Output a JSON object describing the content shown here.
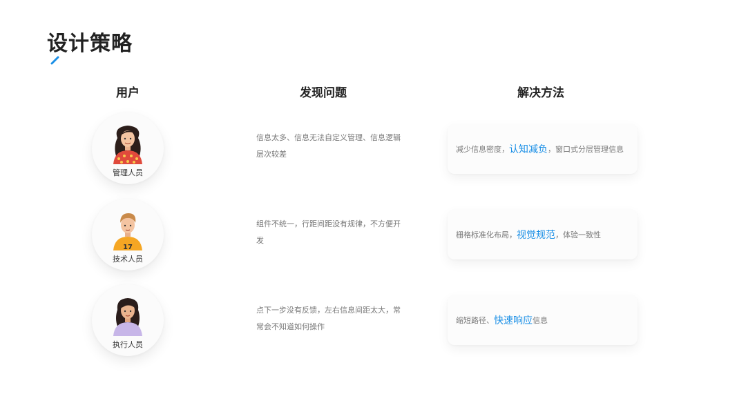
{
  "page": {
    "title": "设计策略",
    "accent_color": "#1a8fe6"
  },
  "columns": {
    "users": "用户",
    "problems": "发现问题",
    "solutions": "解决方法"
  },
  "rows": [
    {
      "user": "管理人员",
      "problem": "信息太多、信息无法自定义管理、信息逻辑层次较差",
      "solution": {
        "before": "减少信息密度，",
        "highlight": "认知减负",
        "after": "，窗口式分层管理信息"
      }
    },
    {
      "user": "技术人员",
      "problem": "组件不统一，行距间距没有规律，不方便开发",
      "solution": {
        "before": "栅格标准化布局，",
        "highlight": "视觉规范",
        "after": "，体验一致性"
      }
    },
    {
      "user": "执行人员",
      "problem": "点下一步没有反馈，左右信息间距太大，常常会不知道如何操作",
      "solution": {
        "before": "缩短路径、",
        "highlight": "快速响应",
        "after": "信息"
      }
    }
  ]
}
